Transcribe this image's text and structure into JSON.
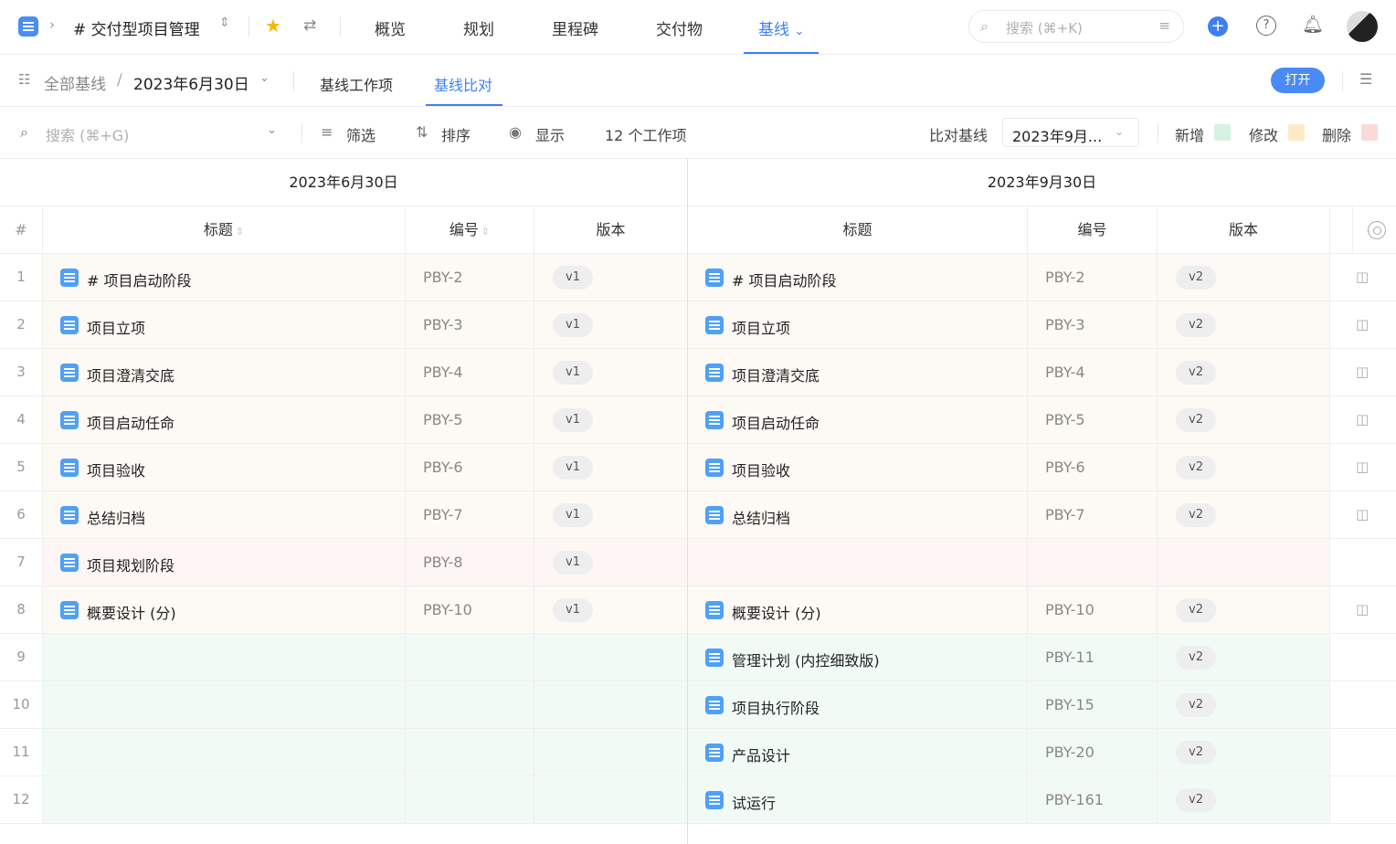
{
  "topbar": {
    "project_name": "# 交付型项目管理",
    "tabs": [
      "概览",
      "规划",
      "里程碑",
      "交付物",
      "基线"
    ],
    "active_tab": "基线",
    "search_placeholder": "搜索 (⌘+K)"
  },
  "subbar": {
    "all_baselines": "全部基线",
    "current_baseline": "2023年6月30日",
    "tabs": [
      "基线工作项",
      "基线比对"
    ],
    "active_tab": "基线比对",
    "open_button": "打开"
  },
  "toolbar": {
    "search_placeholder": "搜索 (⌘+G)",
    "filter": "筛选",
    "sort": "排序",
    "display": "显示",
    "count_label": "12 个工作项",
    "compare_label": "比对基线",
    "compare_value": "2023年9月...",
    "legend": [
      {
        "label": "新增",
        "color": "#d6f2e0"
      },
      {
        "label": "修改",
        "color": "#fdebc8"
      },
      {
        "label": "删除",
        "color": "#fbd9d9"
      }
    ]
  },
  "colors": {
    "accent": "#3d7ff5",
    "modified_row": "#fdf9f4",
    "added_row": "#f2faf6",
    "deleted_row": "#fdf6f5"
  },
  "left": {
    "title": "2023年6月30日",
    "headers": {
      "num": "#",
      "title": "标题",
      "code": "编号",
      "version": "版本"
    }
  },
  "right": {
    "title": "2023年9月30日",
    "headers": {
      "title": "标题",
      "code": "编号",
      "version": "版本"
    }
  },
  "rows": [
    {
      "n": "1",
      "status": "modified",
      "left": {
        "title": "# 项目启动阶段",
        "code": "PBY-2",
        "ver": "v1"
      },
      "right": {
        "title": "# 项目启动阶段",
        "code": "PBY-2",
        "ver": "v2"
      }
    },
    {
      "n": "2",
      "status": "modified",
      "left": {
        "title": "项目立项",
        "code": "PBY-3",
        "ver": "v1"
      },
      "right": {
        "title": "项目立项",
        "code": "PBY-3",
        "ver": "v2"
      }
    },
    {
      "n": "3",
      "status": "modified",
      "left": {
        "title": "项目澄清交底",
        "code": "PBY-4",
        "ver": "v1"
      },
      "right": {
        "title": "项目澄清交底",
        "code": "PBY-4",
        "ver": "v2"
      }
    },
    {
      "n": "4",
      "status": "modified",
      "left": {
        "title": "项目启动任命",
        "code": "PBY-5",
        "ver": "v1"
      },
      "right": {
        "title": "项目启动任命",
        "code": "PBY-5",
        "ver": "v2"
      }
    },
    {
      "n": "5",
      "status": "modified",
      "left": {
        "title": "项目验收",
        "code": "PBY-6",
        "ver": "v1"
      },
      "right": {
        "title": "项目验收",
        "code": "PBY-6",
        "ver": "v2"
      }
    },
    {
      "n": "6",
      "status": "modified",
      "left": {
        "title": "总结归档",
        "code": "PBY-7",
        "ver": "v1"
      },
      "right": {
        "title": "总结归档",
        "code": "PBY-7",
        "ver": "v2"
      }
    },
    {
      "n": "7",
      "status": "deleted",
      "left": {
        "title": "项目规划阶段",
        "code": "PBY-8",
        "ver": "v1"
      },
      "right": null
    },
    {
      "n": "8",
      "status": "modified",
      "left": {
        "title": "概要设计 (分)",
        "code": "PBY-10",
        "ver": "v1"
      },
      "right": {
        "title": "概要设计 (分)",
        "code": "PBY-10",
        "ver": "v2"
      }
    },
    {
      "n": "9",
      "status": "added",
      "left": null,
      "right": {
        "title": "管理计划 (内控细致版)",
        "code": "PBY-11",
        "ver": "v2"
      }
    },
    {
      "n": "10",
      "status": "added",
      "left": null,
      "right": {
        "title": "项目执行阶段",
        "code": "PBY-15",
        "ver": "v2"
      }
    },
    {
      "n": "11",
      "status": "added",
      "left": null,
      "right": {
        "title": "产品设计",
        "code": "PBY-20",
        "ver": "v2"
      }
    },
    {
      "n": "12",
      "status": "added",
      "left": null,
      "right": {
        "title": "试运行",
        "code": "PBY-161",
        "ver": "v2"
      }
    }
  ]
}
